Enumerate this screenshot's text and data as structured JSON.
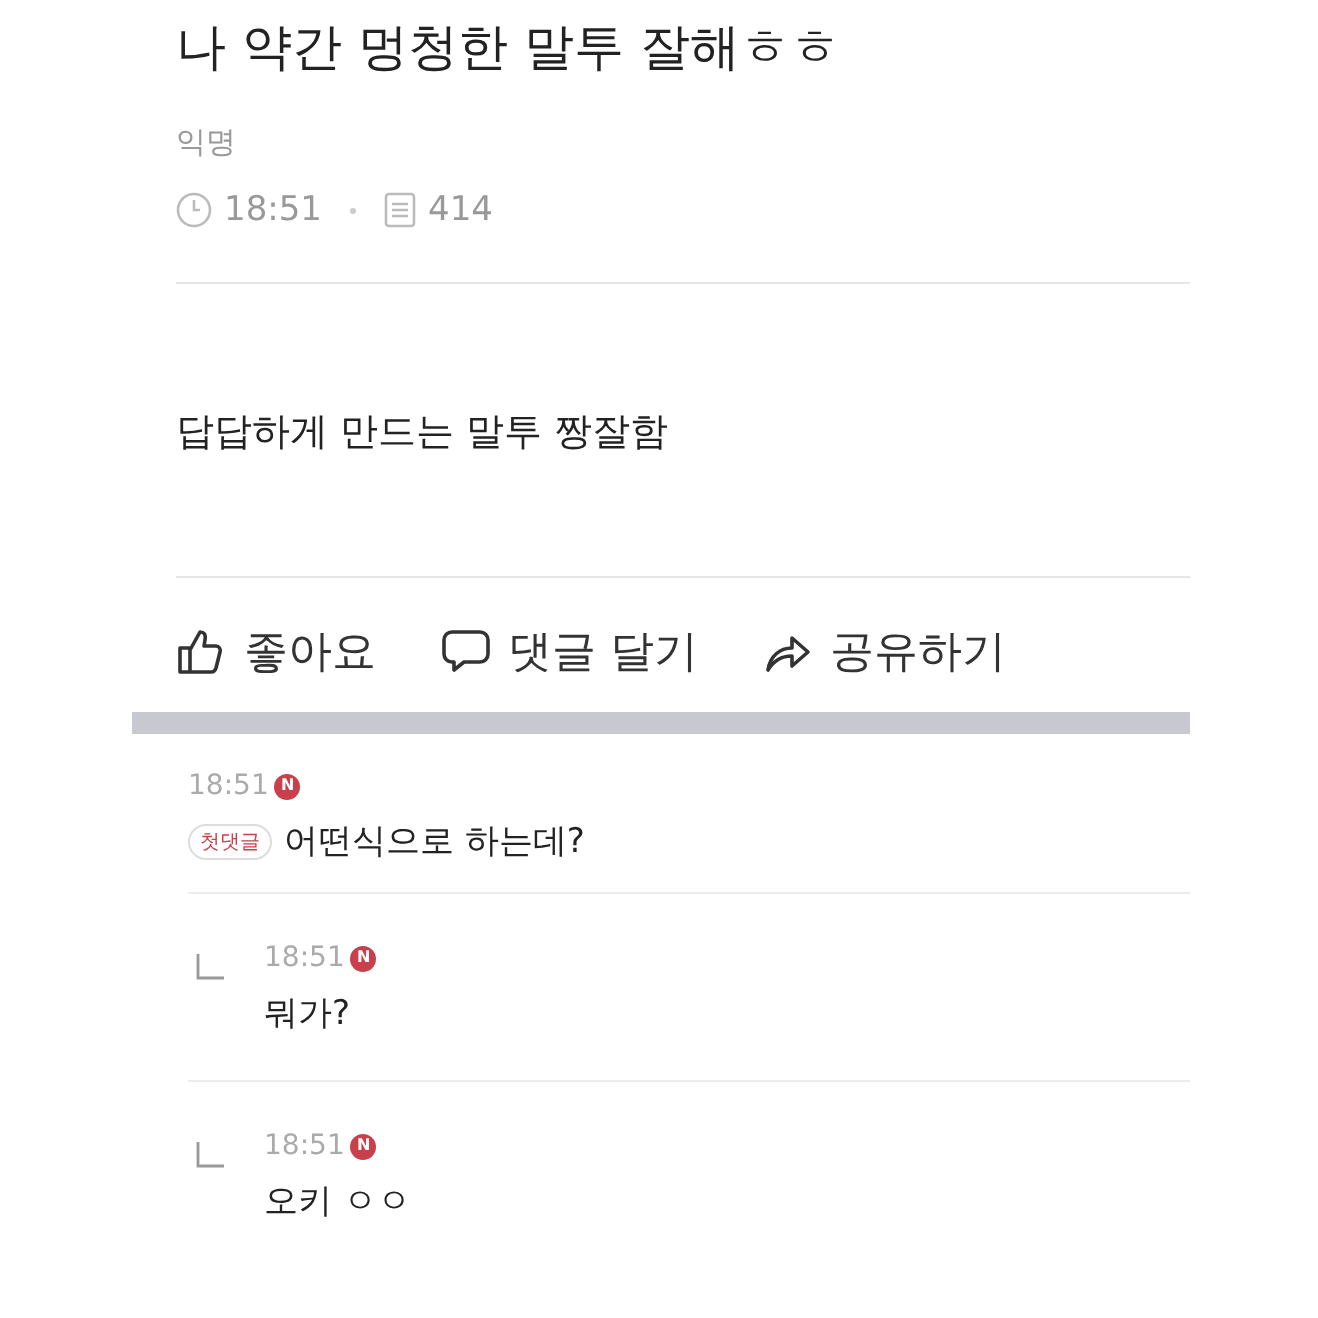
{
  "post": {
    "title": "나 약간 멍청한 말투 잘해ㅎㅎ",
    "author": "익명",
    "time": "18:51",
    "views": "414",
    "body": "답답하게 만드는 말투 짱잘함"
  },
  "actions": [
    {
      "kind": "like",
      "label": "좋아요"
    },
    {
      "kind": "comment",
      "label": "댓글 달기"
    },
    {
      "kind": "share",
      "label": "공유하기"
    }
  ],
  "comments": [
    {
      "kind": "comment",
      "time": "18:51",
      "new_badge": "N",
      "tag": "첫댓글",
      "text": "어떤식으로 하는데?"
    },
    {
      "kind": "reply",
      "time": "18:51",
      "new_badge": "N",
      "text": "뭐가?"
    },
    {
      "kind": "reply",
      "time": "18:51",
      "new_badge": "N",
      "text": "오키 ㅇㅇ"
    }
  ]
}
